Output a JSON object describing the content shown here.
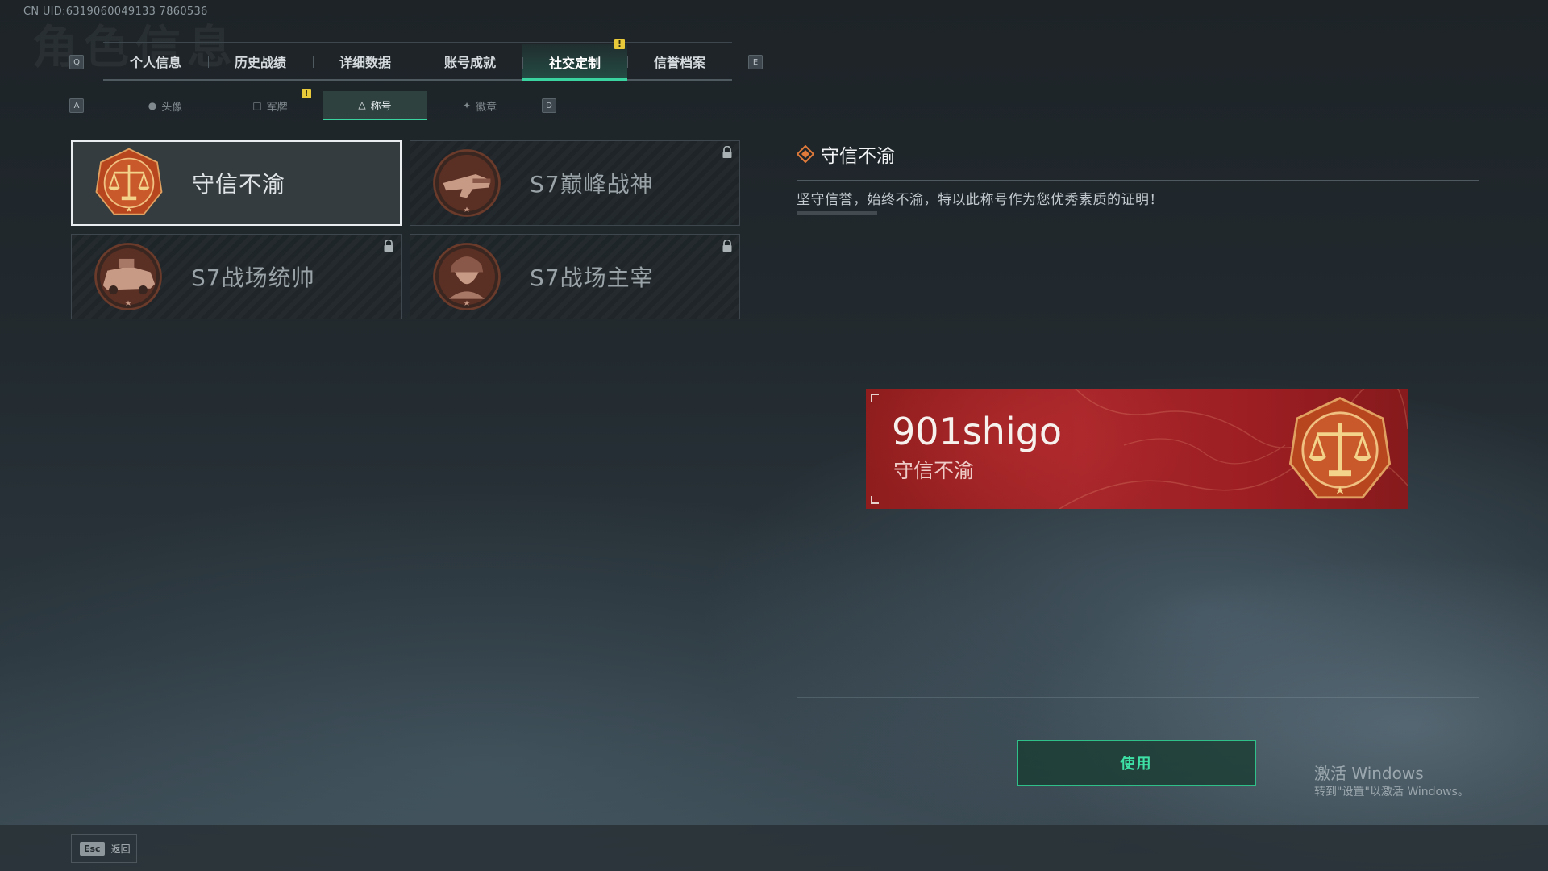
{
  "uid": "CN UID:6319060049133 7860536",
  "bg_title": "角色信息",
  "main_tabs": {
    "left_key": "Q",
    "right_key": "E",
    "items": [
      {
        "label": "个人信息"
      },
      {
        "label": "历史战绩"
      },
      {
        "label": "详细数据"
      },
      {
        "label": "账号成就"
      },
      {
        "label": "社交定制",
        "active": true
      },
      {
        "label": "信誉档案"
      }
    ]
  },
  "sub_tabs": {
    "left_key": "A",
    "right_key": "D",
    "items": [
      {
        "label": "头像",
        "icon": "person-icon"
      },
      {
        "label": "军牌",
        "icon": "dogtag-icon"
      },
      {
        "label": "称号",
        "icon": "title-icon",
        "active": true
      },
      {
        "label": "徽章",
        "icon": "badge-icon"
      }
    ]
  },
  "notice_mark": "!",
  "titles": [
    {
      "label": "守信不渝",
      "emblem": "scales-emblem",
      "locked": false,
      "selected": true
    },
    {
      "label": "S7巅峰战神",
      "emblem": "gun-emblem",
      "locked": true,
      "selected": false
    },
    {
      "label": "S7战场统帅",
      "emblem": "vehicle-emblem",
      "locked": true,
      "selected": false
    },
    {
      "label": "S7战场主宰",
      "emblem": "soldier-emblem",
      "locked": true,
      "selected": false
    }
  ],
  "detail": {
    "title": "守信不渝",
    "description": "坚守信誉，始终不渝，特以此称号作为您优秀素质的证明！"
  },
  "banner": {
    "player_name": "901shigo",
    "title": "守信不渝"
  },
  "use_button": "使用",
  "activate_windows": {
    "line1": "激活 Windows",
    "line2": "转到\"设置\"以激活 Windows。"
  },
  "esc": {
    "key": "Esc",
    "label": "返回"
  },
  "colors": {
    "accent": "#39d4a0",
    "banner_red": "#a5262a",
    "notice": "#e8c93a"
  }
}
